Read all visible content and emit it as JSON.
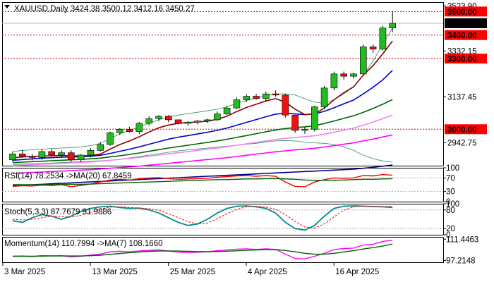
{
  "chart_data": [
    {
      "type": "candlestick",
      "title": "XAUUSD,Daily",
      "ohlc_header": "3424.38 3500.12 3412.16 3450.27",
      "x_dates": [
        "3 Mar 2025",
        "13 Mar 2025",
        "25 Mar 2025",
        "4 Apr 2025",
        "16 Apr 2025"
      ],
      "y_ticks": [
        "3523.90",
        "3332.15",
        "3137.45",
        "2942.75"
      ],
      "price_badges": [
        {
          "text": "3500.00",
          "color": "#ff0000"
        },
        {
          "text": "3450.27",
          "color": "#000000"
        },
        {
          "text": "3400.00",
          "color": "#ff0000"
        },
        {
          "text": "3300.00",
          "color": "#ff0000"
        },
        {
          "text": "3000.00",
          "color": "#ff0000"
        }
      ],
      "h_lines": [
        3500,
        3400,
        3300,
        3000
      ],
      "ylim": [
        2845,
        3540
      ],
      "candles": [
        [
          2870,
          2905,
          2860,
          2895
        ],
        [
          2895,
          2912,
          2880,
          2885
        ],
        [
          2885,
          2895,
          2868,
          2880
        ],
        [
          2880,
          2915,
          2870,
          2905
        ],
        [
          2905,
          2915,
          2885,
          2890
        ],
        [
          2890,
          2910,
          2878,
          2900
        ],
        [
          2900,
          2910,
          2860,
          2870
        ],
        [
          2870,
          2895,
          2860,
          2890
        ],
        [
          2890,
          2920,
          2880,
          2910
        ],
        [
          2910,
          2945,
          2905,
          2935
        ],
        [
          2935,
          2990,
          2930,
          2985
        ],
        [
          2985,
          3005,
          2975,
          3000
        ],
        [
          3000,
          3010,
          2985,
          2990
        ],
        [
          2990,
          3030,
          2980,
          3025
        ],
        [
          3025,
          3055,
          3015,
          3045
        ],
        [
          3045,
          3060,
          3035,
          3055
        ],
        [
          3055,
          3060,
          3030,
          3040
        ],
        [
          3040,
          3035,
          3020,
          3025
        ],
        [
          3025,
          3035,
          3015,
          3030
        ],
        [
          3030,
          3040,
          3020,
          3035
        ],
        [
          3035,
          3045,
          3025,
          3040
        ],
        [
          3040,
          3075,
          3035,
          3065
        ],
        [
          3065,
          3100,
          3060,
          3090
        ],
        [
          3090,
          3135,
          3085,
          3125
        ],
        [
          3125,
          3150,
          3115,
          3140
        ],
        [
          3140,
          3150,
          3125,
          3130
        ],
        [
          3130,
          3160,
          3120,
          3150
        ],
        [
          3150,
          3165,
          3138,
          3145
        ],
        [
          3145,
          3150,
          3050,
          3060
        ],
        [
          3060,
          3050,
          2985,
          2995
        ],
        [
          2995,
          3010,
          2980,
          3000
        ],
        [
          3000,
          3100,
          2990,
          3095
        ],
        [
          3095,
          3185,
          3085,
          3175
        ],
        [
          3175,
          3245,
          3165,
          3235
        ],
        [
          3235,
          3245,
          3210,
          3225
        ],
        [
          3225,
          3240,
          3215,
          3235
        ],
        [
          3235,
          3360,
          3230,
          3350
        ],
        [
          3350,
          3360,
          3325,
          3340
        ],
        [
          3340,
          3440,
          3335,
          3430
        ],
        [
          3430,
          3500,
          3412,
          3450
        ]
      ],
      "series": [
        {
          "name": "",
          "color": "#8b0000",
          "values": [
            2878,
            2882,
            2884,
            2886,
            2887,
            2888,
            2887,
            2886,
            2888,
            2894,
            2915,
            2935,
            2950,
            2968,
            2988,
            3006,
            3018,
            3025,
            3028,
            3031,
            3034,
            3042,
            3055,
            3075,
            3092,
            3106,
            3120,
            3130,
            3115,
            3085,
            3062,
            3065,
            3090,
            3125,
            3155,
            3180,
            3230,
            3270,
            3320,
            3375
          ]
        },
        {
          "name": "",
          "color": "#0000cd",
          "values": [
            2868,
            2871,
            2874,
            2877,
            2879,
            2881,
            2882,
            2883,
            2885,
            2889,
            2897,
            2906,
            2915,
            2925,
            2936,
            2947,
            2958,
            2966,
            2973,
            2980,
            2987,
            2995,
            3005,
            3017,
            3029,
            3041,
            3053,
            3064,
            3068,
            3065,
            3062,
            3065,
            3076,
            3091,
            3108,
            3124,
            3150,
            3178,
            3210,
            3250
          ]
        },
        {
          "name": "",
          "color": "#006400",
          "values": [
            2858,
            2860,
            2862,
            2864,
            2866,
            2868,
            2870,
            2872,
            2874,
            2877,
            2882,
            2887,
            2893,
            2899,
            2906,
            2913,
            2920,
            2926,
            2932,
            2938,
            2944,
            2950,
            2957,
            2965,
            2973,
            2981,
            2989,
            2997,
            3003,
            3007,
            3010,
            3015,
            3024,
            3035,
            3046,
            3057,
            3072,
            3088,
            3106,
            3126
          ]
        },
        {
          "name": "",
          "color": "#ee82ee",
          "values": [
            2845,
            2847,
            2849,
            2851,
            2853,
            2855,
            2857,
            2859,
            2861,
            2864,
            2868,
            2872,
            2876,
            2880,
            2885,
            2890,
            2895,
            2900,
            2905,
            2910,
            2915,
            2920,
            2926,
            2932,
            2938,
            2944,
            2950,
            2956,
            2961,
            2965,
            2968,
            2972,
            2979,
            2987,
            2996,
            3005,
            3017,
            3030,
            3045,
            3060
          ]
        },
        {
          "name": "",
          "color": "#ff00ff",
          "values": [
            2812,
            2814,
            2816,
            2818,
            2820,
            2822,
            2824,
            2826,
            2828,
            2831,
            2834,
            2837,
            2840,
            2843,
            2847,
            2851,
            2855,
            2859,
            2863,
            2867,
            2871,
            2875,
            2879,
            2884,
            2889,
            2894,
            2899,
            2904,
            2908,
            2912,
            2915,
            2919,
            2924,
            2930,
            2936,
            2942,
            2950,
            2958,
            2967,
            2976
          ]
        },
        {
          "name": "",
          "color": "#00008b",
          "values": [
            2760,
            2762,
            2764,
            2766,
            2768,
            2770,
            2772,
            2774,
            2776,
            2778,
            2780,
            2782,
            2784,
            2786,
            2788,
            2790,
            2792,
            2794,
            2796,
            2798,
            2800,
            2802,
            2804,
            2806,
            2808,
            2810,
            2812,
            2814,
            2816,
            2818,
            2820,
            2822,
            2824,
            2826,
            2828,
            2830,
            2834,
            2838,
            2843,
            2848
          ]
        },
        {
          "name": "",
          "color": "#2e8b57",
          "upper": [
            2905,
            2910,
            2912,
            2915,
            2918,
            2920,
            2922,
            2925,
            2930,
            2940,
            2960,
            2980,
            2995,
            3010,
            3025,
            3040,
            3052,
            3060,
            3066,
            3072,
            3078,
            3085,
            3095,
            3110,
            3122,
            3132,
            3142,
            3150,
            3150,
            3145,
            3130,
            3115,
            3110,
            3125,
            3150,
            3180,
            3230,
            3290,
            3360,
            3430
          ],
          "lower": [
            2850,
            2852,
            2853,
            2854,
            2856,
            2858,
            2860,
            2862,
            2864,
            2866,
            2868,
            2872,
            2878,
            2884,
            2890,
            2896,
            2902,
            2908,
            2912,
            2916,
            2920,
            2924,
            2928,
            2932,
            2936,
            2940,
            2946,
            2950,
            2952,
            2950,
            2945,
            2942,
            2940,
            2935,
            2925,
            2910,
            2890,
            2875,
            2865,
            2860
          ]
        }
      ]
    },
    {
      "type": "line",
      "title": "RSI(14) 78.2534  ->MA(20) 67.8459",
      "y_ticks": [
        "100",
        "70",
        "30",
        "0"
      ],
      "ylim": [
        0,
        100
      ],
      "series": [
        {
          "name": "",
          "color": "#ff0000",
          "values": [
            45,
            47,
            46,
            49,
            48,
            50,
            44,
            48,
            52,
            58,
            64,
            66,
            64,
            68,
            70,
            71,
            68,
            66,
            67,
            68,
            69,
            72,
            74,
            76,
            77,
            75,
            77,
            75,
            58,
            45,
            44,
            58,
            65,
            70,
            69,
            70,
            77,
            76,
            80,
            78
          ]
        },
        {
          "name": "",
          "color": "#006400",
          "values": [
            50,
            50,
            50,
            50,
            50,
            51,
            51,
            51,
            52,
            53,
            54,
            55,
            56,
            57,
            58,
            59,
            60,
            61,
            62,
            63,
            64,
            65,
            65,
            66,
            67,
            67,
            68,
            68,
            67,
            66,
            64,
            63,
            63,
            63,
            64,
            65,
            66,
            66,
            67,
            68
          ]
        }
      ]
    },
    {
      "type": "line",
      "title": "Stoch(5,3,3) 87.7679 91.9886",
      "y_ticks": [
        "100",
        "80",
        "20",
        "0"
      ],
      "ylim": [
        0,
        100
      ],
      "series": [
        {
          "name": "",
          "color": "#008b8b",
          "values": [
            45,
            40,
            55,
            65,
            60,
            50,
            60,
            75,
            85,
            90,
            92,
            88,
            85,
            86,
            80,
            70,
            55,
            40,
            30,
            35,
            50,
            70,
            85,
            92,
            93,
            90,
            85,
            70,
            40,
            20,
            15,
            30,
            60,
            85,
            92,
            93,
            92,
            91,
            90,
            88
          ]
        },
        {
          "name": "",
          "color": "#ff0000",
          "values": [
            50,
            48,
            50,
            55,
            60,
            58,
            57,
            63,
            73,
            83,
            89,
            90,
            88,
            86,
            84,
            79,
            68,
            55,
            42,
            35,
            38,
            52,
            68,
            82,
            90,
            92,
            89,
            82,
            65,
            43,
            25,
            22,
            35,
            58,
            79,
            90,
            92,
            92,
            91,
            92
          ]
        }
      ]
    },
    {
      "type": "line",
      "title": "Momentum(14) 110.7994  ->MA(7) 108.1660",
      "y_ticks": [
        "111.4463",
        "97.2148"
      ],
      "ylim": [
        96,
        113
      ],
      "series": [
        {
          "name": "",
          "color": "#ff00ff",
          "values": [
            100,
            100.2,
            99.8,
            100.5,
            100.3,
            100.4,
            99.5,
            100,
            100.8,
            101.5,
            103,
            103.4,
            103,
            103.6,
            104,
            104.2,
            103.5,
            102.8,
            102.5,
            102.7,
            103,
            103.8,
            104.2,
            104.8,
            105,
            104.6,
            105,
            104.6,
            101.5,
            98.5,
            98.2,
            100,
            102,
            104.5,
            105.2,
            105.5,
            107.5,
            108,
            110,
            110.8
          ]
        },
        {
          "name": "",
          "color": "#006400",
          "values": [
            100,
            100,
            100,
            100.1,
            100.2,
            100.3,
            100.2,
            100.2,
            100.4,
            100.7,
            101.3,
            101.9,
            102.4,
            102.9,
            103.3,
            103.5,
            103.6,
            103.5,
            103.3,
            103.2,
            103.1,
            103.2,
            103.4,
            103.7,
            104,
            104.2,
            104.4,
            104.5,
            103.9,
            103,
            102,
            101.4,
            101.4,
            102,
            102.9,
            103.8,
            104.9,
            105.8,
            106.9,
            108.2
          ]
        }
      ]
    }
  ]
}
